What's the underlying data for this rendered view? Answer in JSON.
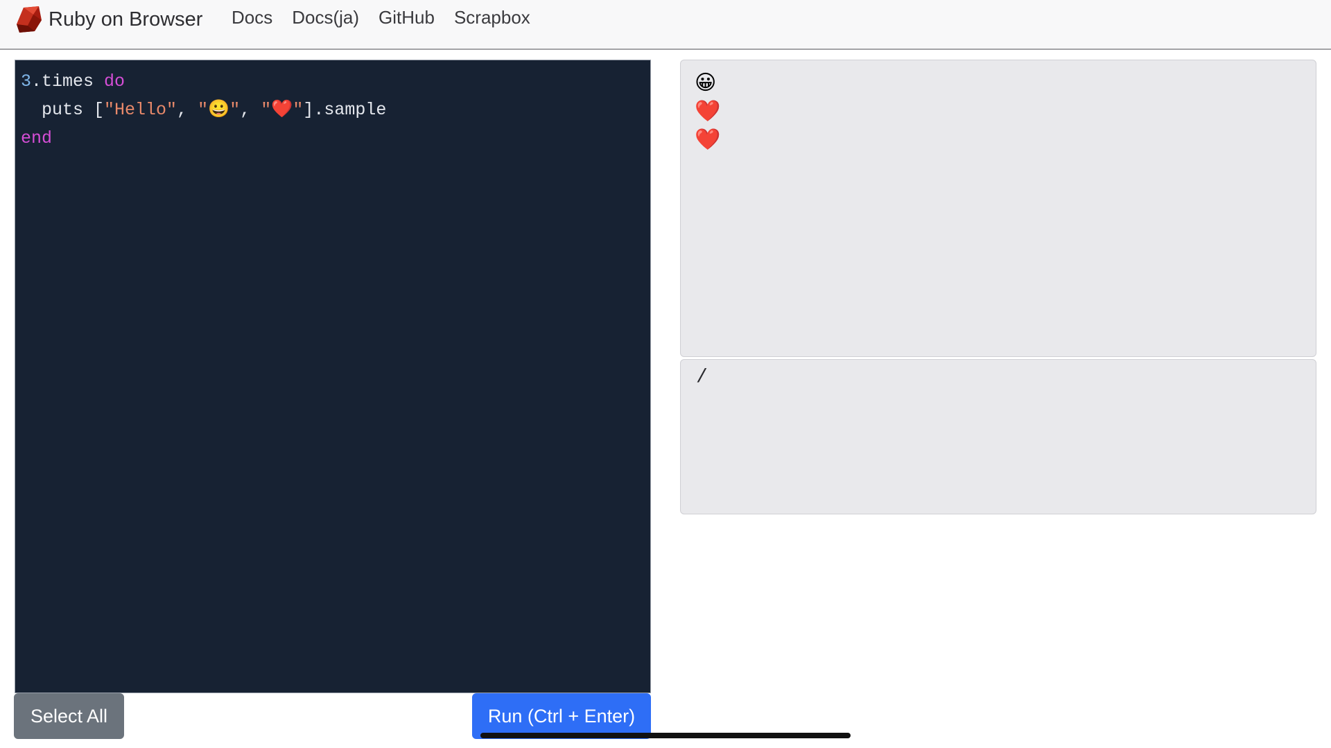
{
  "brand": {
    "name": "Ruby on Browser",
    "logo_icon": "ruby-gem-icon"
  },
  "nav": {
    "links": [
      {
        "label": "Docs"
      },
      {
        "label": "Docs(ja)"
      },
      {
        "label": "GitHub"
      },
      {
        "label": "Scrapbox"
      }
    ]
  },
  "editor": {
    "lines": [
      [
        {
          "type": "num",
          "text": "3"
        },
        {
          "type": "plain",
          "text": ".times "
        },
        {
          "type": "kw",
          "text": "do"
        }
      ],
      [
        {
          "type": "plain",
          "text": "  puts ["
        },
        {
          "type": "str",
          "text": "\"Hello\""
        },
        {
          "type": "plain",
          "text": ", "
        },
        {
          "type": "str",
          "text": "\"😀\""
        },
        {
          "type": "plain",
          "text": ", "
        },
        {
          "type": "str",
          "text": "\"❤️\""
        },
        {
          "type": "plain",
          "text": "].sample"
        }
      ],
      [
        {
          "type": "kw",
          "text": "end"
        }
      ]
    ],
    "colors": {
      "background": "#172233",
      "keyword": "#d54ed6",
      "string": "#e8896a",
      "number": "#7fb5e8"
    }
  },
  "output": {
    "lines": [
      "😀",
      "❤️",
      "❤️"
    ]
  },
  "stdin": {
    "value": "/"
  },
  "buttons": {
    "select_all": "Select All",
    "run": "Run (Ctrl + Enter)"
  },
  "colors": {
    "run_button": "#2e6ef6",
    "select_button": "#6b737c"
  }
}
